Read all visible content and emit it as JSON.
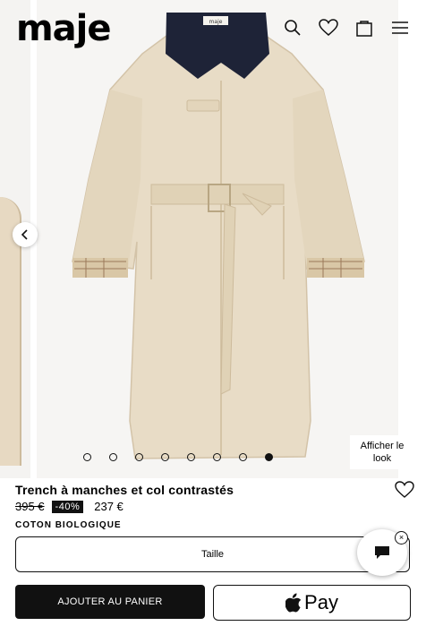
{
  "header": {
    "logo": "maje",
    "icons": [
      "search-icon",
      "heart-icon",
      "bag-icon",
      "menu-icon"
    ]
  },
  "gallery": {
    "slide_count": 8,
    "active_slide": 8,
    "look_button": "Afficher le look",
    "prev_icon": "chevron-left-icon",
    "collar_label": "maje"
  },
  "product": {
    "title": "Trench à manches et col contrastés",
    "old_price": "395 €",
    "discount": "-40%",
    "price": "237 €",
    "material": "COTON BIOLOGIQUE",
    "size_label": "Taille",
    "add_to_cart": "AJOUTER AU PANIER",
    "pay_label": "Pay",
    "chat_close": "×"
  },
  "colors": {
    "coat": "#e7dcc7",
    "collar": "#1e2337",
    "background": "#f6f5f3",
    "button_dark": "#111111"
  }
}
